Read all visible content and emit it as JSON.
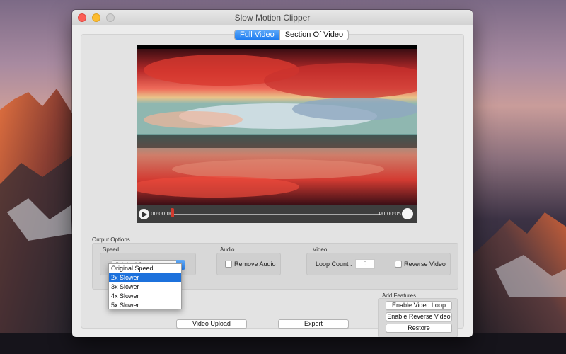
{
  "window": {
    "title": "Slow Motion Clipper"
  },
  "tabs": {
    "full_video": "Full Video",
    "section_of_video": "Section Of Video",
    "active": "Full Video"
  },
  "player": {
    "current_time": "00:00:00",
    "duration": "00:00:05",
    "progress": 0.0
  },
  "output": {
    "title": "Output Options",
    "speed": {
      "label": "Speed",
      "selected": "Original Speed",
      "options": [
        "Original Speed",
        "2x Slower",
        "3x Slower",
        "4x Slower",
        "5x Slower"
      ],
      "highlighted": "2x Slower"
    },
    "audio": {
      "label": "Audio",
      "remove_audio": "Remove Audio",
      "remove_audio_checked": false
    },
    "video": {
      "label": "Video",
      "loop_count_label": "Loop Count :",
      "loop_count_placeholder": "0",
      "reverse_video": "Reverse Video",
      "reverse_video_checked": false
    }
  },
  "actions": {
    "video_upload": "Video Upload",
    "export": "Export"
  },
  "features": {
    "title": "Add Features",
    "enable_video_loop": "Enable Video Loop",
    "enable_reverse_video": "Enable Reverse Video",
    "restore": "Restore"
  },
  "colors": {
    "accent": "#1c71dc",
    "window_bg": "#ececec"
  }
}
